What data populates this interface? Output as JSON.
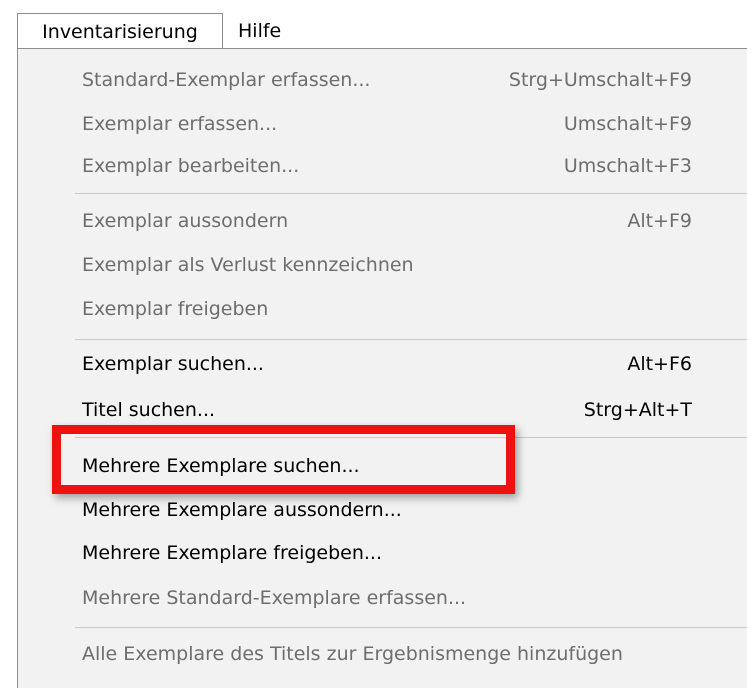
{
  "menubar": {
    "items": [
      {
        "label": "Inventarisierung"
      },
      {
        "label": "Hilfe"
      }
    ]
  },
  "menu": {
    "items": [
      {
        "label": "Standard-Exemplar erfassen...",
        "shortcut": "Strg+Umschalt+F9",
        "enabled": false
      },
      {
        "label": "Exemplar erfassen...",
        "shortcut": "Umschalt+F9",
        "enabled": false
      },
      {
        "label": "Exemplar bearbeiten...",
        "shortcut": "Umschalt+F3",
        "enabled": false
      },
      {
        "label": "Exemplar aussondern",
        "shortcut": "Alt+F9",
        "enabled": false
      },
      {
        "label": "Exemplar als Verlust kennzeichnen",
        "shortcut": "",
        "enabled": false
      },
      {
        "label": "Exemplar freigeben",
        "shortcut": "",
        "enabled": false
      },
      {
        "label": "Exemplar suchen...",
        "shortcut": "Alt+F6",
        "enabled": true
      },
      {
        "label": "Titel suchen...",
        "shortcut": "Strg+Alt+T",
        "enabled": true
      },
      {
        "label": "Mehrere Exemplare suchen...",
        "shortcut": "",
        "enabled": true
      },
      {
        "label": "Mehrere Exemplare aussondern...",
        "shortcut": "",
        "enabled": true
      },
      {
        "label": "Mehrere Exemplare freigeben...",
        "shortcut": "",
        "enabled": true
      },
      {
        "label": "Mehrere Standard-Exemplare erfassen...",
        "shortcut": "",
        "enabled": false
      },
      {
        "label": "Alle Exemplare des Titels zur Ergebnismenge hinzufügen",
        "shortcut": "",
        "enabled": false
      }
    ]
  },
  "colors": {
    "highlight": "#ee1111",
    "disabled_text": "#6d6d6d",
    "enabled_text": "#000000",
    "menu_background": "#f2f2f2"
  }
}
